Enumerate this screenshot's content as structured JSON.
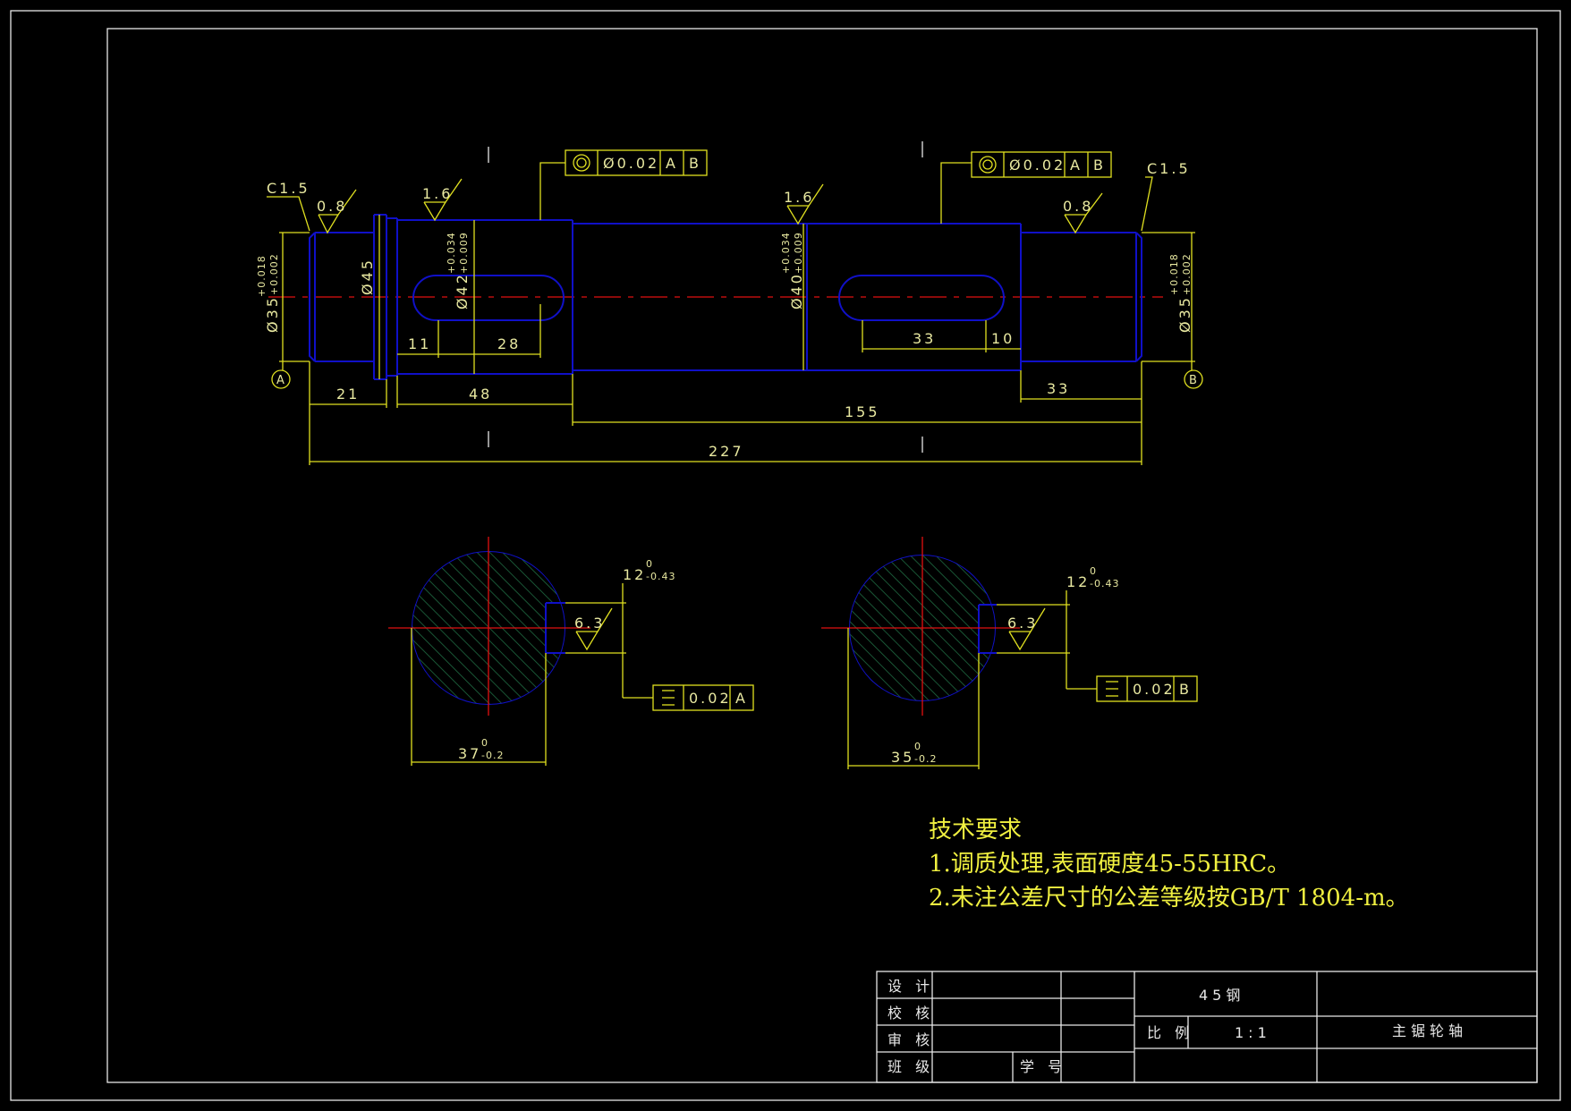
{
  "shaft_dims": {
    "c15_left": "C1.5",
    "c15_right": "C1.5",
    "ra08_left": "0.8",
    "ra16_left": "1.6",
    "ra16_mid": "1.6",
    "ra08_right": "0.8",
    "tol_ref_left": "A",
    "tol_ref_right": "B",
    "dia35_left": "Ø35",
    "dia35_tol_up": "+0.018",
    "dia35_tol_low": "+0.002",
    "dia45": "Ø45",
    "dia42": "Ø42",
    "dia42_tol_up": "+0.034",
    "dia42_tol_low": "+0.009",
    "dia40": "Ø40",
    "dia40_tol_up": "+0.034",
    "dia40_tol_low": "+0.009",
    "dia35_right": "Ø35",
    "d11": "11",
    "d28": "28",
    "d21": "21",
    "d48": "48",
    "d33_key": "33",
    "d10": "10",
    "d33_end": "33",
    "d155": "155",
    "d227": "227",
    "coax_left": {
      "sym": "◎",
      "val": "Ø0.02",
      "ref1": "A",
      "ref2": "B"
    },
    "coax_right": {
      "sym": "◎",
      "val": "Ø0.02",
      "ref1": "A",
      "ref2": "B"
    }
  },
  "sections": {
    "left": {
      "key_w": "12",
      "key_tol_up": "0",
      "key_tol_low": "-0.43",
      "ra": "6.3",
      "sym_val": "0.02",
      "sym_ref": "A",
      "depth": "37",
      "depth_tol_up": "0",
      "depth_tol_low": "-0.2"
    },
    "right": {
      "key_w": "12",
      "key_tol_up": "0",
      "key_tol_low": "-0.43",
      "ra": "6.3",
      "sym_val": "0.02",
      "sym_ref": "B",
      "depth": "35",
      "depth_tol_up": "0",
      "depth_tol_low": "-0.2"
    }
  },
  "requirements": {
    "title": "技术要求",
    "item1": "1.调质处理,表面硬度45-55HRC。",
    "item2": "2.未注公差尺寸的公差等级按GB/T 1804-m。"
  },
  "title_block": {
    "design": "设 计",
    "check": "校 核",
    "review": "审 核",
    "class": "班 级",
    "student_no": "学 号",
    "material": "45钢",
    "scale_label": "比 例",
    "scale": "1:1",
    "part_name": "主锯轮轴"
  }
}
